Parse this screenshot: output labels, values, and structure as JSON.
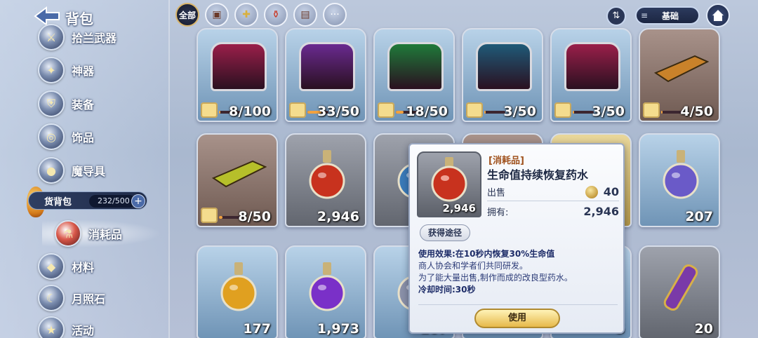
{
  "header": {
    "title": "背包"
  },
  "sidebar": {
    "items": [
      {
        "label": "拾兰武器"
      },
      {
        "label": "神器"
      },
      {
        "label": "装备"
      },
      {
        "label": "饰品"
      },
      {
        "label": "魔导具"
      },
      {
        "label": "材料"
      },
      {
        "label": "月照石"
      },
      {
        "label": "活动"
      }
    ],
    "bag": {
      "label": "货背包",
      "count": "232/500"
    },
    "sub_item": {
      "label": "消耗品"
    }
  },
  "filters": [
    {
      "label": "全部",
      "icon": "all-icon",
      "active": true
    },
    {
      "label": "",
      "icon": "chest-icon"
    },
    {
      "label": "",
      "icon": "puzzle-icon"
    },
    {
      "label": "",
      "icon": "potion-icon"
    },
    {
      "label": "",
      "icon": "map-icon"
    },
    {
      "label": "",
      "icon": "more-icon"
    }
  ],
  "toolbar": {
    "sort_icon": "sort-icon",
    "mode_label": "基础",
    "home_icon": "home-icon"
  },
  "items": [
    {
      "qty": "8/100",
      "kind": "chest",
      "color": "#9a1f4a",
      "frame": "blue",
      "progress": 0.08
    },
    {
      "qty": "33/50",
      "kind": "chest",
      "color": "#6a2a90",
      "frame": "blue",
      "progress": 0.66
    },
    {
      "qty": "18/50",
      "kind": "chest",
      "color": "#1f7a3a",
      "frame": "blue",
      "progress": 0.36
    },
    {
      "qty": "3/50",
      "kind": "chest",
      "color": "#1f5a78",
      "frame": "blue",
      "progress": 0.06
    },
    {
      "qty": "3/50",
      "kind": "chest",
      "color": "#9a1f4a",
      "frame": "blue",
      "progress": 0.06
    },
    {
      "qty": "4/50",
      "kind": "scroll",
      "color": "#c9822a",
      "frame": "brown",
      "progress": 0.08
    },
    {
      "qty": "8/50",
      "kind": "scroll",
      "color": "#b6bf2a",
      "frame": "brown",
      "progress": 0.16
    },
    {
      "qty": "2,946",
      "kind": "potion",
      "color": "#c8321e",
      "frame": "grey"
    },
    {
      "qty": "",
      "kind": "potion",
      "color": "#3a7ab8",
      "frame": "grey"
    },
    {
      "qty": "",
      "kind": "potion",
      "color": "#c8321e",
      "frame": "brown"
    },
    {
      "qty": "",
      "kind": "potion",
      "color": "#d8a030",
      "frame": "gold"
    },
    {
      "qty": "207",
      "kind": "potion",
      "color": "#6a5ac8",
      "frame": "blue"
    },
    {
      "qty": "177",
      "kind": "potion",
      "color": "#e0a020",
      "frame": "blue"
    },
    {
      "qty": "1,973",
      "kind": "potion",
      "color": "#7a30c8",
      "frame": "blue"
    },
    {
      "qty": "167",
      "kind": "potion",
      "color": "#8a90a8",
      "frame": "blue"
    },
    {
      "qty": "",
      "kind": "potion",
      "color": "#8a90a8",
      "frame": "blue"
    },
    {
      "qty": "5",
      "kind": "potion",
      "color": "#8a90a8",
      "frame": "blue"
    },
    {
      "qty": "20",
      "kind": "staff",
      "color": "#7a3aa8",
      "frame": "grey"
    }
  ],
  "popup": {
    "category": "[消耗品]",
    "name": "生命值持续恢复药水",
    "thumb_qty": "2,946",
    "sell_label": "出售",
    "sell_price": "40",
    "own_label": "拥有:",
    "own_count": "2,946",
    "obtain_label": "获得途径",
    "effect_label": "使用效果:",
    "effect_text": "在10秒内恢复30%生命值",
    "desc_1": "商人协会和学者们共同研发。",
    "desc_2": "为了能大量出售,制作而成的改良型药水。",
    "cooldown": "冷却时间:30秒",
    "use_label": "使用"
  }
}
